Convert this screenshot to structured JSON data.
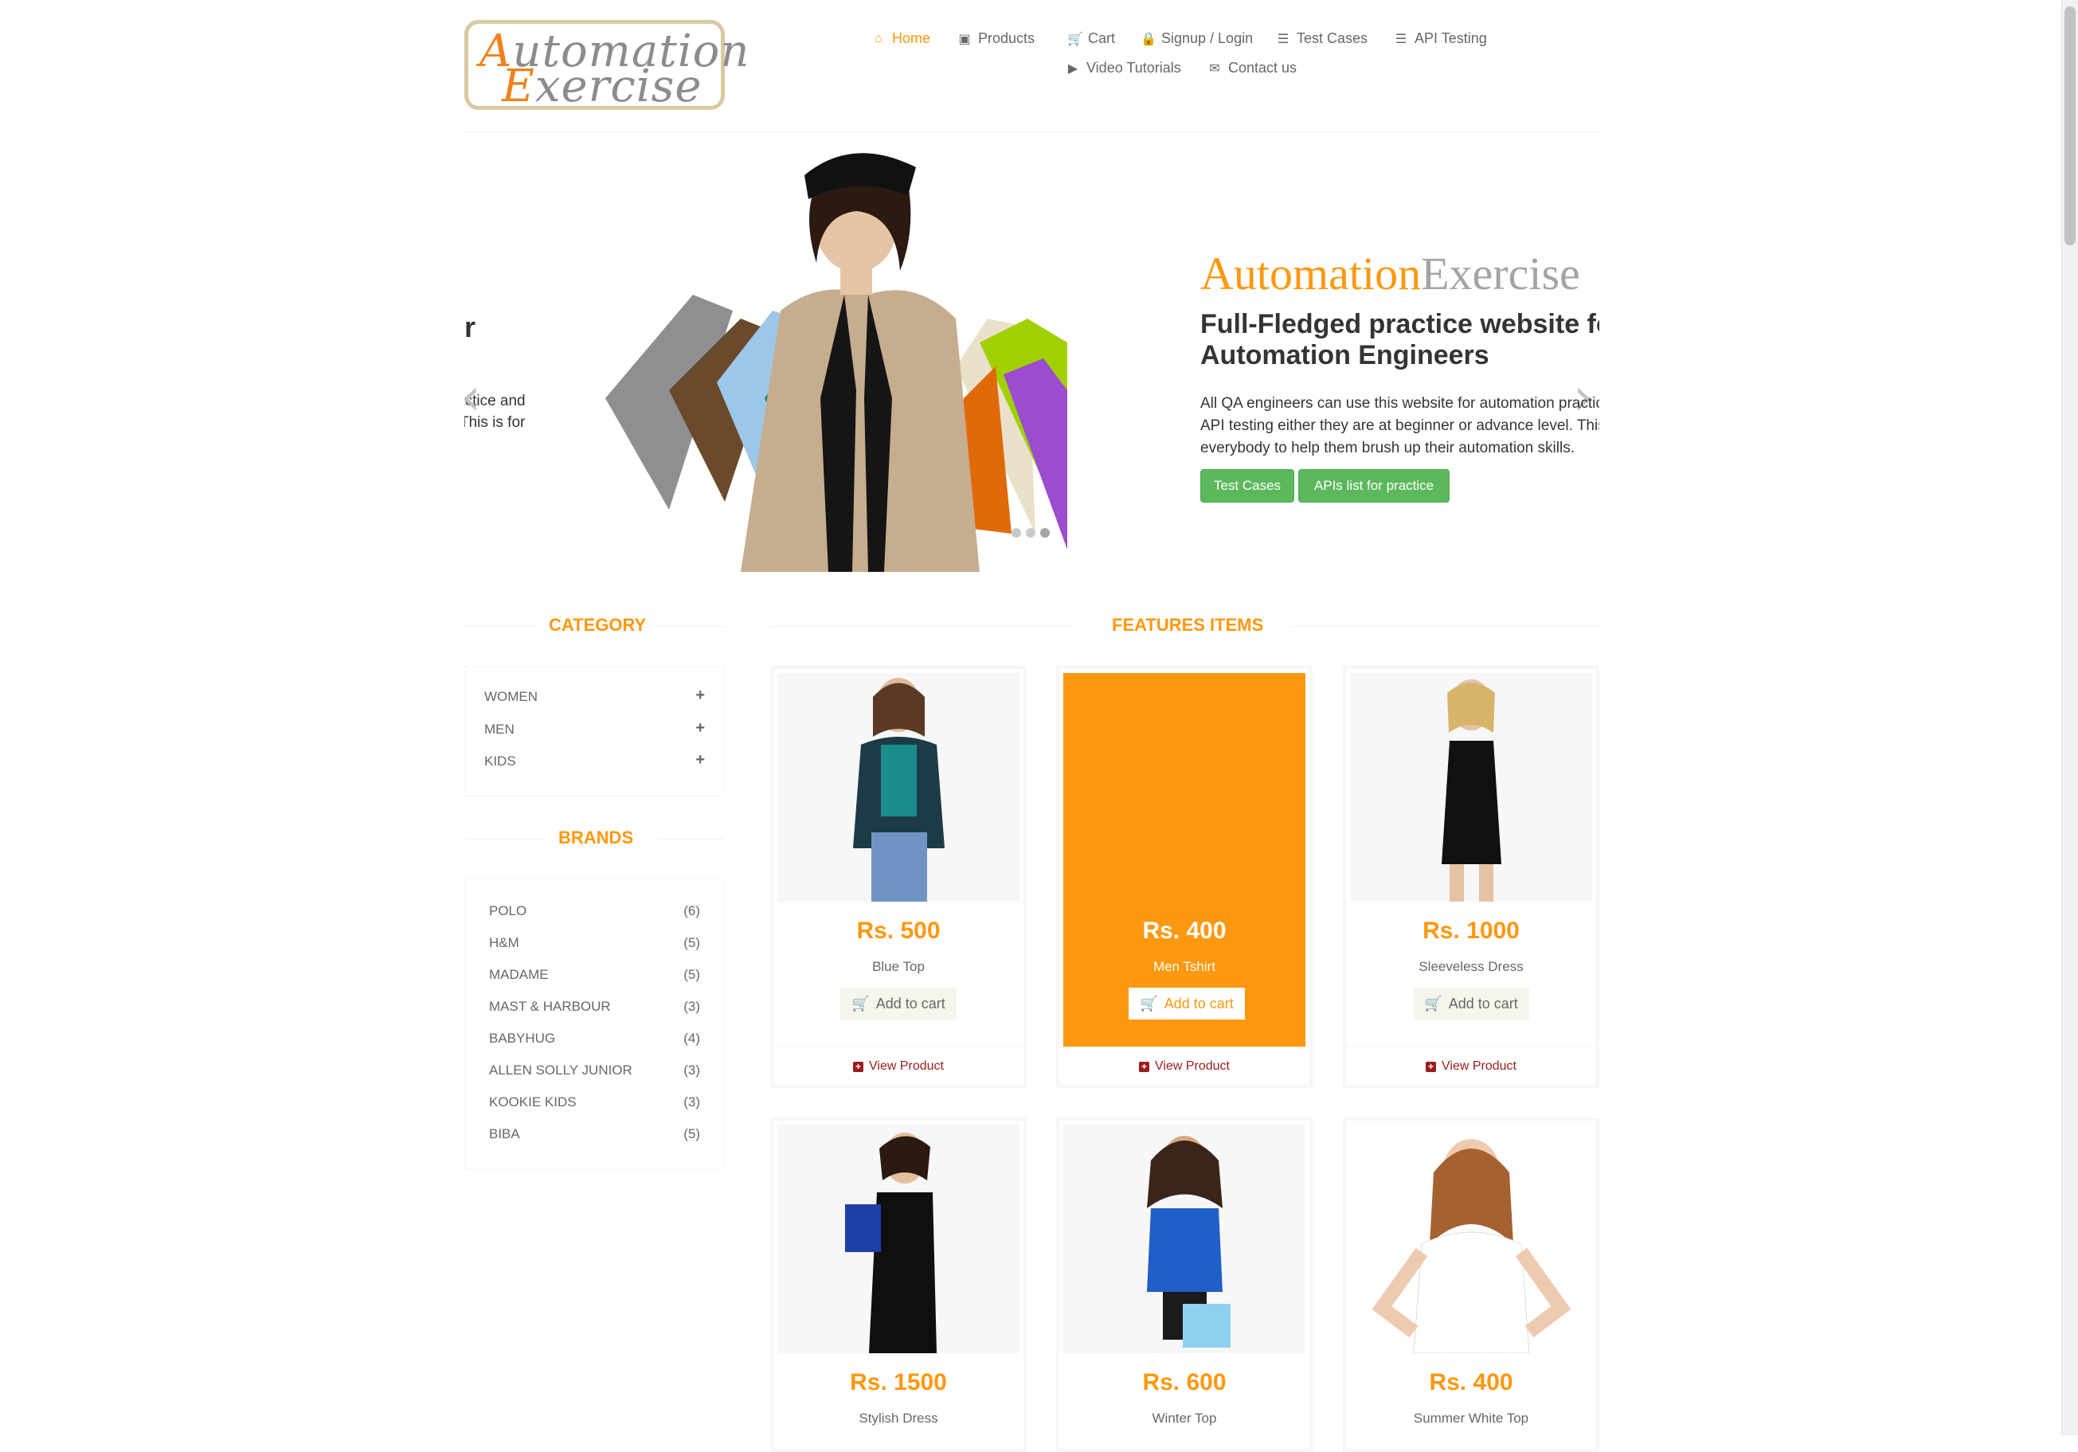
{
  "logo": {
    "line1_first": "A",
    "line1_rest": "utomation",
    "line2_first": "E",
    "line2_rest": "xercise"
  },
  "nav": {
    "home": "Home",
    "products": "Products",
    "cart": "Cart",
    "signup": "Signup / Login",
    "test_cases": "Test Cases",
    "api_testing": "API Testing",
    "video": "Video Tutorials",
    "contact": "Contact us"
  },
  "slider": {
    "prev_partial_title": "r",
    "prev_partial_line1": "actice and",
    "prev_partial_line2": "This is for",
    "brand_a": "Automation",
    "brand_b": "Exercise",
    "heading_line1": "Full-Fledged practice website for",
    "heading_line2": "Automation Engineers",
    "para_line1": "All QA engineers can use this website for automation practice and",
    "para_line2": "API testing either they are at beginner or advance level. This is for",
    "para_line3": "everybody to help them brush up their automation skills.",
    "btn_test_cases": "Test Cases",
    "btn_apis": "APIs list for practice"
  },
  "sidebar": {
    "category_title": "CATEGORY",
    "categories": [
      "WOMEN",
      "MEN",
      "KIDS"
    ],
    "brands_title": "BRANDS",
    "brands": [
      {
        "name": "POLO",
        "count": "(6)"
      },
      {
        "name": "H&M",
        "count": "(5)"
      },
      {
        "name": "MADAME",
        "count": "(5)"
      },
      {
        "name": "MAST & HARBOUR",
        "count": "(3)"
      },
      {
        "name": "BABYHUG",
        "count": "(4)"
      },
      {
        "name": "ALLEN SOLLY JUNIOR",
        "count": "(3)"
      },
      {
        "name": "KOOKIE KIDS",
        "count": "(3)"
      },
      {
        "name": "BIBA",
        "count": "(5)"
      }
    ]
  },
  "features": {
    "title": "FEATURES ITEMS",
    "add_to_cart": "Add to cart",
    "view_product": "View Product",
    "products": [
      {
        "price": "Rs. 500",
        "name": "Blue Top"
      },
      {
        "price": "Rs. 400",
        "name": "Men Tshirt"
      },
      {
        "price": "Rs. 1000",
        "name": "Sleeveless Dress"
      },
      {
        "price": "Rs. 1500",
        "name": "Stylish Dress"
      },
      {
        "price": "Rs. 600",
        "name": "Winter Top"
      },
      {
        "price": "Rs. 400",
        "name": "Summer White Top"
      }
    ]
  },
  "colors": {
    "accent": "#fe980f",
    "green": "#5cb85c",
    "text": "#696763",
    "link": "#9b1c1c"
  }
}
